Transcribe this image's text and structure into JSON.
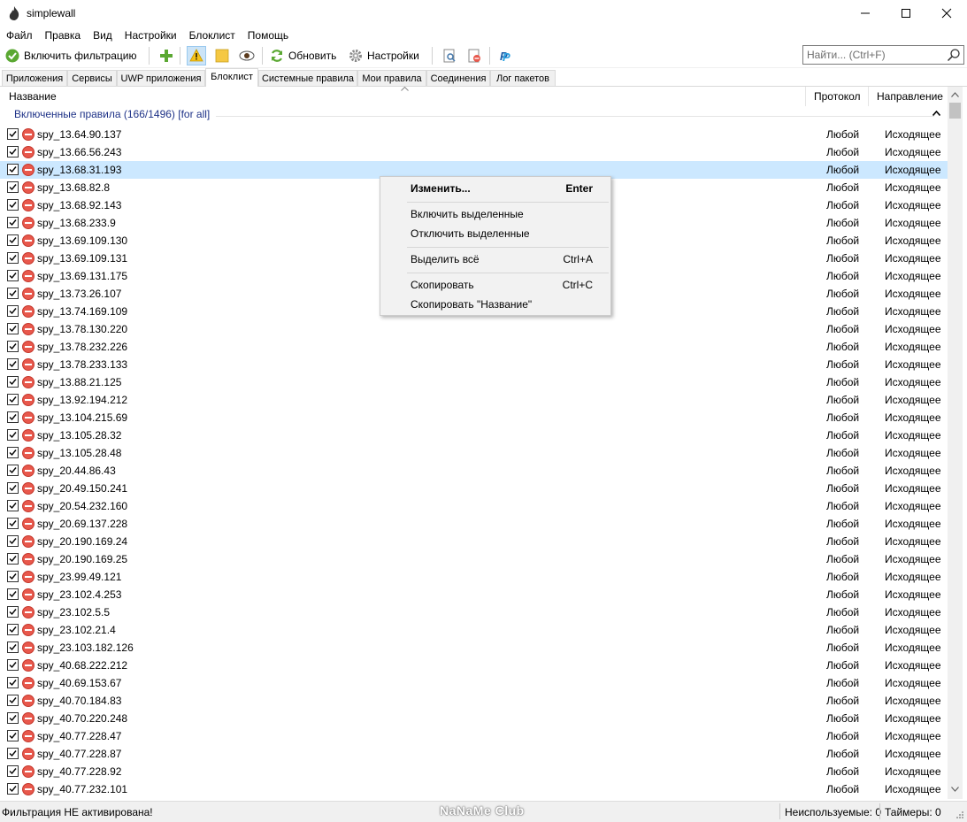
{
  "window": {
    "title": "simplewall"
  },
  "menu": [
    "Файл",
    "Правка",
    "Вид",
    "Настройки",
    "Блоклист",
    "Помощь"
  ],
  "toolbar": {
    "enable_filter_label": "Включить фильтрацию",
    "refresh_label": "Обновить",
    "settings_label": "Настройки"
  },
  "search": {
    "placeholder": "Найти... (Ctrl+F)"
  },
  "tabs": [
    "Приложения",
    "Сервисы",
    "UWP приложения",
    "Блоклист",
    "Системные правила",
    "Мои правила",
    "Соединения",
    "Лог пакетов"
  ],
  "active_tab": "Блоклист",
  "columns": {
    "name": "Название",
    "protocol": "Протокол",
    "direction": "Направление"
  },
  "group": {
    "title": "Включенные правила (166/1496) [for all]"
  },
  "rows": [
    {
      "name": "spy_13.64.90.137",
      "protocol": "Любой",
      "direction": "Исходящее"
    },
    {
      "name": "spy_13.66.56.243",
      "protocol": "Любой",
      "direction": "Исходящее"
    },
    {
      "name": "spy_13.68.31.193",
      "protocol": "Любой",
      "direction": "Исходящее",
      "selected": true
    },
    {
      "name": "spy_13.68.82.8",
      "protocol": "Любой",
      "direction": "Исходящее"
    },
    {
      "name": "spy_13.68.92.143",
      "protocol": "Любой",
      "direction": "Исходящее"
    },
    {
      "name": "spy_13.68.233.9",
      "protocol": "Любой",
      "direction": "Исходящее"
    },
    {
      "name": "spy_13.69.109.130",
      "protocol": "Любой",
      "direction": "Исходящее"
    },
    {
      "name": "spy_13.69.109.131",
      "protocol": "Любой",
      "direction": "Исходящее"
    },
    {
      "name": "spy_13.69.131.175",
      "protocol": "Любой",
      "direction": "Исходящее"
    },
    {
      "name": "spy_13.73.26.107",
      "protocol": "Любой",
      "direction": "Исходящее"
    },
    {
      "name": "spy_13.74.169.109",
      "protocol": "Любой",
      "direction": "Исходящее"
    },
    {
      "name": "spy_13.78.130.220",
      "protocol": "Любой",
      "direction": "Исходящее"
    },
    {
      "name": "spy_13.78.232.226",
      "protocol": "Любой",
      "direction": "Исходящее"
    },
    {
      "name": "spy_13.78.233.133",
      "protocol": "Любой",
      "direction": "Исходящее"
    },
    {
      "name": "spy_13.88.21.125",
      "protocol": "Любой",
      "direction": "Исходящее"
    },
    {
      "name": "spy_13.92.194.212",
      "protocol": "Любой",
      "direction": "Исходящее"
    },
    {
      "name": "spy_13.104.215.69",
      "protocol": "Любой",
      "direction": "Исходящее"
    },
    {
      "name": "spy_13.105.28.32",
      "protocol": "Любой",
      "direction": "Исходящее"
    },
    {
      "name": "spy_13.105.28.48",
      "protocol": "Любой",
      "direction": "Исходящее"
    },
    {
      "name": "spy_20.44.86.43",
      "protocol": "Любой",
      "direction": "Исходящее"
    },
    {
      "name": "spy_20.49.150.241",
      "protocol": "Любой",
      "direction": "Исходящее"
    },
    {
      "name": "spy_20.54.232.160",
      "protocol": "Любой",
      "direction": "Исходящее"
    },
    {
      "name": "spy_20.69.137.228",
      "protocol": "Любой",
      "direction": "Исходящее"
    },
    {
      "name": "spy_20.190.169.24",
      "protocol": "Любой",
      "direction": "Исходящее"
    },
    {
      "name": "spy_20.190.169.25",
      "protocol": "Любой",
      "direction": "Исходящее"
    },
    {
      "name": "spy_23.99.49.121",
      "protocol": "Любой",
      "direction": "Исходящее"
    },
    {
      "name": "spy_23.102.4.253",
      "protocol": "Любой",
      "direction": "Исходящее"
    },
    {
      "name": "spy_23.102.5.5",
      "protocol": "Любой",
      "direction": "Исходящее"
    },
    {
      "name": "spy_23.102.21.4",
      "protocol": "Любой",
      "direction": "Исходящее"
    },
    {
      "name": "spy_23.103.182.126",
      "protocol": "Любой",
      "direction": "Исходящее"
    },
    {
      "name": "spy_40.68.222.212",
      "protocol": "Любой",
      "direction": "Исходящее"
    },
    {
      "name": "spy_40.69.153.67",
      "protocol": "Любой",
      "direction": "Исходящее"
    },
    {
      "name": "spy_40.70.184.83",
      "protocol": "Любой",
      "direction": "Исходящее"
    },
    {
      "name": "spy_40.70.220.248",
      "protocol": "Любой",
      "direction": "Исходящее"
    },
    {
      "name": "spy_40.77.228.47",
      "protocol": "Любой",
      "direction": "Исходящее"
    },
    {
      "name": "spy_40.77.228.87",
      "protocol": "Любой",
      "direction": "Исходящее"
    },
    {
      "name": "spy_40.77.228.92",
      "protocol": "Любой",
      "direction": "Исходящее"
    },
    {
      "name": "spy_40.77.232.101",
      "protocol": "Любой",
      "direction": "Исходящее"
    }
  ],
  "context_menu": {
    "edit": "Изменить...",
    "edit_key": "Enter",
    "enable_selected": "Включить выделенные",
    "disable_selected": "Отключить выделенные",
    "select_all": "Выделить всё",
    "select_all_key": "Ctrl+A",
    "copy": "Скопировать",
    "copy_key": "Ctrl+C",
    "copy_name": "Скопировать \"Название\""
  },
  "status": {
    "left": "Фильтрация НЕ активирована!",
    "watermark": "NaNaMe Club",
    "unused": "Неиспользуемые: 0",
    "timers": "Таймеры: 0"
  },
  "colors": {
    "selection": "#cce8ff",
    "group_title": "#1e3287",
    "block_icon": "#e8584c"
  }
}
